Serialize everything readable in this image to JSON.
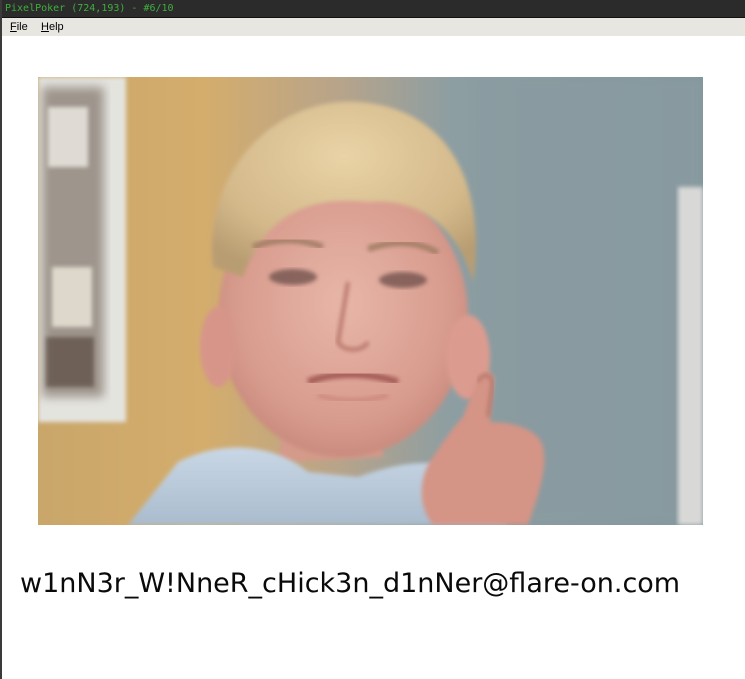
{
  "window": {
    "title": "PixelPoker (724,193) - #6/10"
  },
  "menubar": {
    "file_label": "File",
    "file_rest": "ile",
    "file_mnemonic": "F",
    "help_label": "Help",
    "help_rest": "elp",
    "help_mnemonic": "H"
  },
  "content": {
    "image_subject": "photo of a boy giving a thumbs-up",
    "message": "w1nN3r_W!NneR_cHick3n_d1nNer@flare-on.com"
  },
  "colors": {
    "titlebar_bg": "#2b2b2b",
    "title_text": "#3fae3f",
    "menubar_bg": "#e8e6e1",
    "text": "#0a0a0a"
  }
}
